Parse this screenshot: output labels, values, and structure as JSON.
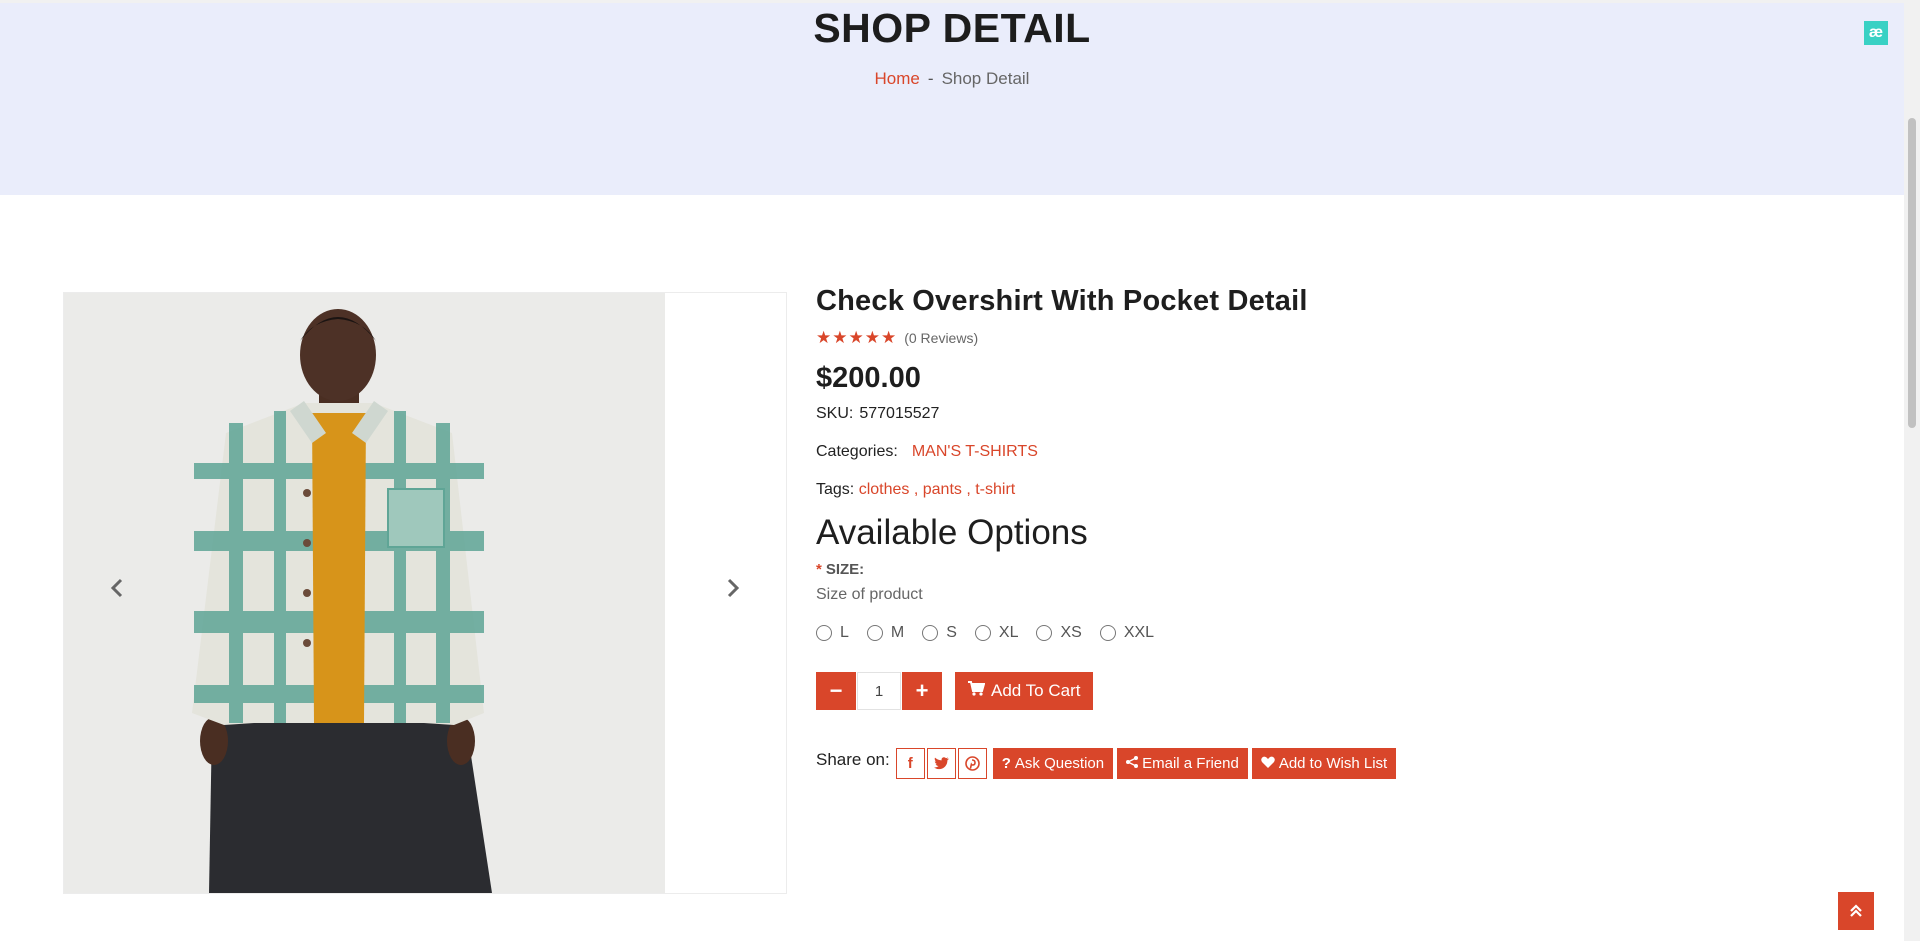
{
  "hero": {
    "title": "SHOP DETAIL",
    "breadcrumb": {
      "home": "Home",
      "separator": "-",
      "current": "Shop Detail"
    },
    "badge": "æ"
  },
  "product": {
    "title": "Check Overshirt With Pocket Detail",
    "rating": {
      "stars": "★★★★★",
      "reviews": "(0 Reviews)"
    },
    "price": "$200.00",
    "sku_label": "SKU:",
    "sku": "577015527",
    "categories_label": "Categories:",
    "category": "MAN'S T-SHIRTS",
    "tags_label": "Tags:",
    "tags": [
      "clothes ,",
      "pants ,",
      "t-shirt"
    ]
  },
  "options": {
    "title": "Available Options",
    "required_mark": "*",
    "size_label": "SIZE:",
    "size_description": "Size of product",
    "sizes": [
      "L",
      "M",
      "S",
      "XL",
      "XS",
      "XXL"
    ]
  },
  "cart": {
    "minus": "−",
    "plus": "+",
    "quantity": "1",
    "add_to_cart": "Add To Cart"
  },
  "share": {
    "label": "Share on:",
    "networks": [
      "facebook",
      "twitter",
      "pinterest"
    ],
    "ask_question": "Ask Question",
    "email_friend": "Email a Friend",
    "wish_list": "Add to Wish List"
  },
  "colors": {
    "accent": "#d9462a",
    "hero_bg": "#eaedfb"
  },
  "icons": {
    "cart": "cart-icon",
    "question": "question-icon",
    "share": "share-icon",
    "heart": "heart-icon",
    "scroll_top": "double-chevron-up-icon"
  }
}
